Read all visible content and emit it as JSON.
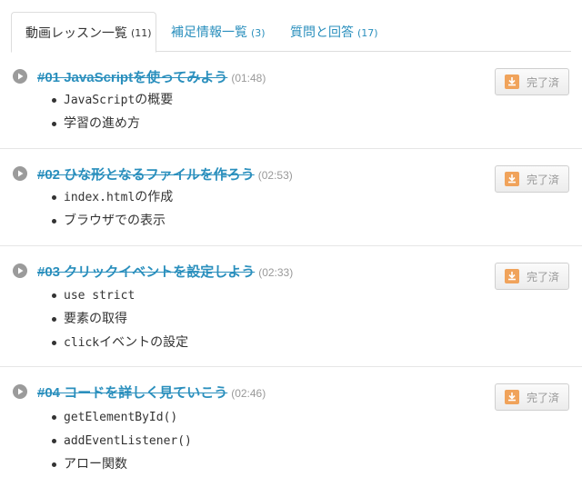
{
  "tabs": [
    {
      "label": "動画レッスン一覧",
      "count": "(11)",
      "active": true
    },
    {
      "label": "補足情報一覧",
      "count": "(3)",
      "active": false
    },
    {
      "label": "質問と回答",
      "count": "(17)",
      "active": false
    }
  ],
  "done_label": "完了済",
  "lessons": [
    {
      "title": "#01 JavaScriptを使ってみよう",
      "duration": "(01:48)",
      "topics": [
        {
          "code": "JavaScript",
          "text": "の概要"
        },
        {
          "code": "",
          "text": "学習の進め方"
        }
      ]
    },
    {
      "title": "#02 ひな形となるファイルを作ろう",
      "duration": "(02:53)",
      "topics": [
        {
          "code": "index.html",
          "text": "の作成"
        },
        {
          "code": "",
          "text": "ブラウザでの表示"
        }
      ]
    },
    {
      "title": "#03 クリックイベントを設定しよう",
      "duration": "(02:33)",
      "topics": [
        {
          "code": "use strict",
          "text": ""
        },
        {
          "code": "",
          "text": "要素の取得"
        },
        {
          "code": "click",
          "text": "イベントの設定"
        }
      ]
    },
    {
      "title": "#04 コードを詳しく見ていこう",
      "duration": "(02:46)",
      "topics": [
        {
          "code": "getElementById()",
          "text": ""
        },
        {
          "code": "addEventListener()",
          "text": ""
        },
        {
          "code": "",
          "text": "アロー関数"
        }
      ]
    }
  ],
  "colors": {
    "link": "#2a8fbd",
    "text": "#333333",
    "muted": "#999999",
    "download_icon": "#f0a35b"
  }
}
